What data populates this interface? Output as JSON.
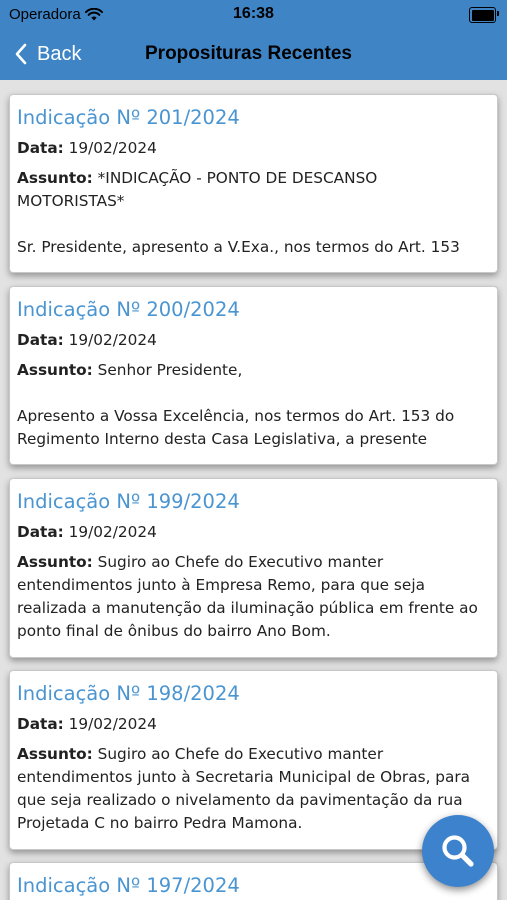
{
  "status_bar": {
    "carrier": "Operadora",
    "time": "16:38"
  },
  "nav": {
    "back_label": "Back",
    "title": "Proposituras Recentes"
  },
  "labels": {
    "date": "Data:",
    "subject": "Assunto:"
  },
  "cards": [
    {
      "title": "Indicação Nº 201/2024",
      "date": "19/02/2024",
      "subject_lines": [
        "*INDICAÇÃO - PONTO DE DESCANSO",
        "MOTORISTAS*"
      ],
      "body_lines": [
        "Sr. Presidente, apresento a V.Exa., nos termos do Art. 153"
      ]
    },
    {
      "title": "Indicação Nº 200/2024",
      "date": "19/02/2024",
      "subject_lines": [
        "Senhor Presidente,"
      ],
      "body_lines": [
        "Apresento a Vossa Excelência, nos termos do Art. 153 do",
        "Regimento Interno desta Casa Legislativa, a presente"
      ]
    },
    {
      "title": "Indicação Nº 199/2024",
      "date": "19/02/2024",
      "subject_lines": [
        "Sugiro ao Chefe do Executivo manter",
        "entendimentos junto à Empresa Remo, para que seja",
        "realizada a manutenção da iluminação pública em frente ao",
        "ponto final de ônibus do bairro Ano Bom."
      ],
      "body_lines": []
    },
    {
      "title": "Indicação Nº 198/2024",
      "date": "19/02/2024",
      "subject_lines": [
        "Sugiro ao Chefe do Executivo manter",
        "entendimentos junto à Secretaria Municipal de Obras, para",
        "que seja realizado o nivelamento da pavimentação da rua",
        "Projetada C no bairro Pedra Mamona."
      ],
      "body_lines": []
    },
    {
      "title": "Indicação Nº 197/2024",
      "date": "",
      "subject_lines": [],
      "body_lines": []
    }
  ],
  "icons": {
    "back": "chevron-left-icon",
    "fab": "search-icon",
    "wifi": "wifi-icon",
    "battery": "battery-icon"
  },
  "colors": {
    "bar": "#3f85c6",
    "card_title": "#4a95d1",
    "fab": "#3d82cc",
    "background": "#e2e2e2"
  }
}
